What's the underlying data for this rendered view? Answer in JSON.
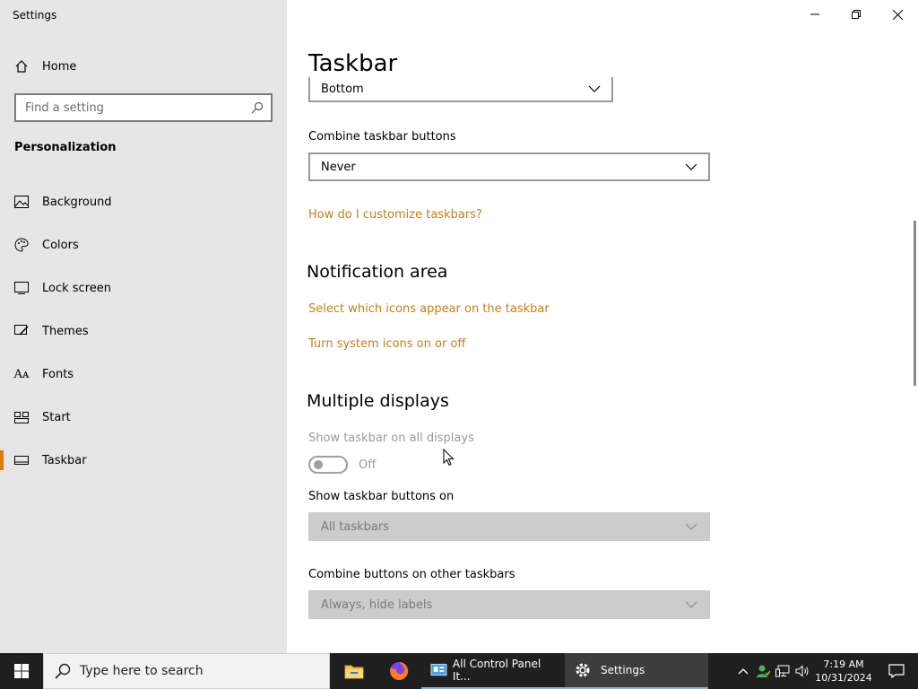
{
  "window": {
    "title": "Settings"
  },
  "sidebar": {
    "home_label": "Home",
    "search_placeholder": "Find a setting",
    "section": "Personalization",
    "items": [
      {
        "label": "Background",
        "icon": "image-icon"
      },
      {
        "label": "Colors",
        "icon": "palette-icon"
      },
      {
        "label": "Lock screen",
        "icon": "lock-screen-icon"
      },
      {
        "label": "Themes",
        "icon": "brush-icon"
      },
      {
        "label": "Fonts",
        "icon": "font-icon"
      },
      {
        "label": "Start",
        "icon": "start-icon"
      },
      {
        "label": "Taskbar",
        "icon": "taskbar-icon",
        "active": true
      }
    ]
  },
  "main": {
    "title": "Taskbar",
    "location_dropdown": {
      "value": "Bottom"
    },
    "combine": {
      "label": "Combine taskbar buttons",
      "value": "Never"
    },
    "link_customize": "How do I customize taskbars?",
    "notification": {
      "heading": "Notification area",
      "link_icons": "Select which icons appear on the taskbar",
      "link_system": "Turn system icons on or off"
    },
    "multiple": {
      "heading": "Multiple displays",
      "show_all_label": "Show taskbar on all displays",
      "toggle_state": "Off",
      "buttons_on_label": "Show taskbar buttons on",
      "buttons_on_value": "All taskbars",
      "combine_other_label": "Combine buttons on other taskbars",
      "combine_other_value": "Always, hide labels"
    }
  },
  "taskbar": {
    "search_placeholder": "Type here to search",
    "apps": [
      {
        "label": "All Control Panel It...",
        "icon": "control-panel-icon"
      },
      {
        "label": "Settings",
        "icon": "gear-icon"
      }
    ],
    "clock_time": "7:19 AM",
    "clock_date": "10/31/2024"
  },
  "colors": {
    "accent": "#e07b00",
    "link": "#c47f17",
    "sidebar_bg": "#e6e6e6",
    "taskbar_bg": "#1f1f1f"
  }
}
